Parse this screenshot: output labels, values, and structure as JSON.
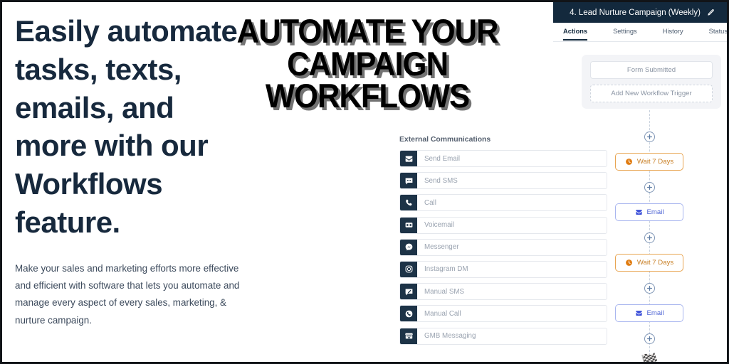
{
  "left_panel": {
    "headline": "Easily automate tasks, texts, emails, and more with our Workflows feature.",
    "subcopy": "Make your sales and marketing efforts more effective and efficient with software that lets you automate and manage every aspect of every sales, marketing, & nurture campaign."
  },
  "overlay_title": {
    "line1": "AUTOMATE YOUR",
    "line2": "CAMPAIGN",
    "line3": "WORKFLOWS",
    "color": "#000000",
    "shadow_color": "#5a5a5a"
  },
  "app": {
    "titlebar": {
      "title": "4. Lead Nurture Campaign (Weekly)",
      "edit_icon": "pencil-icon",
      "background": "#13293d"
    },
    "tabs": [
      {
        "label": "Actions",
        "active": true
      },
      {
        "label": "Settings",
        "active": false
      },
      {
        "label": "History",
        "active": false
      },
      {
        "label": "Status",
        "active": false
      }
    ],
    "trigger": {
      "existing_trigger": "Form Submitted",
      "add_trigger": "Add New Workflow Trigger"
    },
    "action_list": {
      "title": "External Communications",
      "items": [
        {
          "label": "Send Email",
          "icon": "envelope-icon"
        },
        {
          "label": "Send SMS",
          "icon": "chat-bubble-icon"
        },
        {
          "label": "Call",
          "icon": "phone-icon"
        },
        {
          "label": "Voicemail",
          "icon": "voicemail-icon"
        },
        {
          "label": "Messenger",
          "icon": "messenger-icon"
        },
        {
          "label": "Instagram DM",
          "icon": "instagram-icon"
        },
        {
          "label": "Manual SMS",
          "icon": "manual-sms-icon"
        },
        {
          "label": "Manual Call",
          "icon": "manual-call-icon"
        },
        {
          "label": "GMB Messaging",
          "icon": "storefront-icon"
        }
      ]
    },
    "workflow": {
      "steps": [
        {
          "label": "Wait 7 Days",
          "type": "wait",
          "icon": "clock-icon",
          "color": "#c87f25",
          "border": "#e8a552"
        },
        {
          "label": "Email",
          "type": "email",
          "icon": "envelope-icon",
          "color": "#4d63d4",
          "border": "#a9b6ef"
        },
        {
          "label": "Wait 7 Days",
          "type": "wait",
          "icon": "clock-icon",
          "color": "#c87f25",
          "border": "#e8a552"
        },
        {
          "label": "Email",
          "type": "email",
          "icon": "envelope-icon",
          "color": "#4d63d4",
          "border": "#a9b6ef"
        }
      ],
      "add_step_icon": "plus-circle-icon",
      "end_icon": "checkered-flag-icon",
      "end_glyph": "🏁"
    }
  }
}
